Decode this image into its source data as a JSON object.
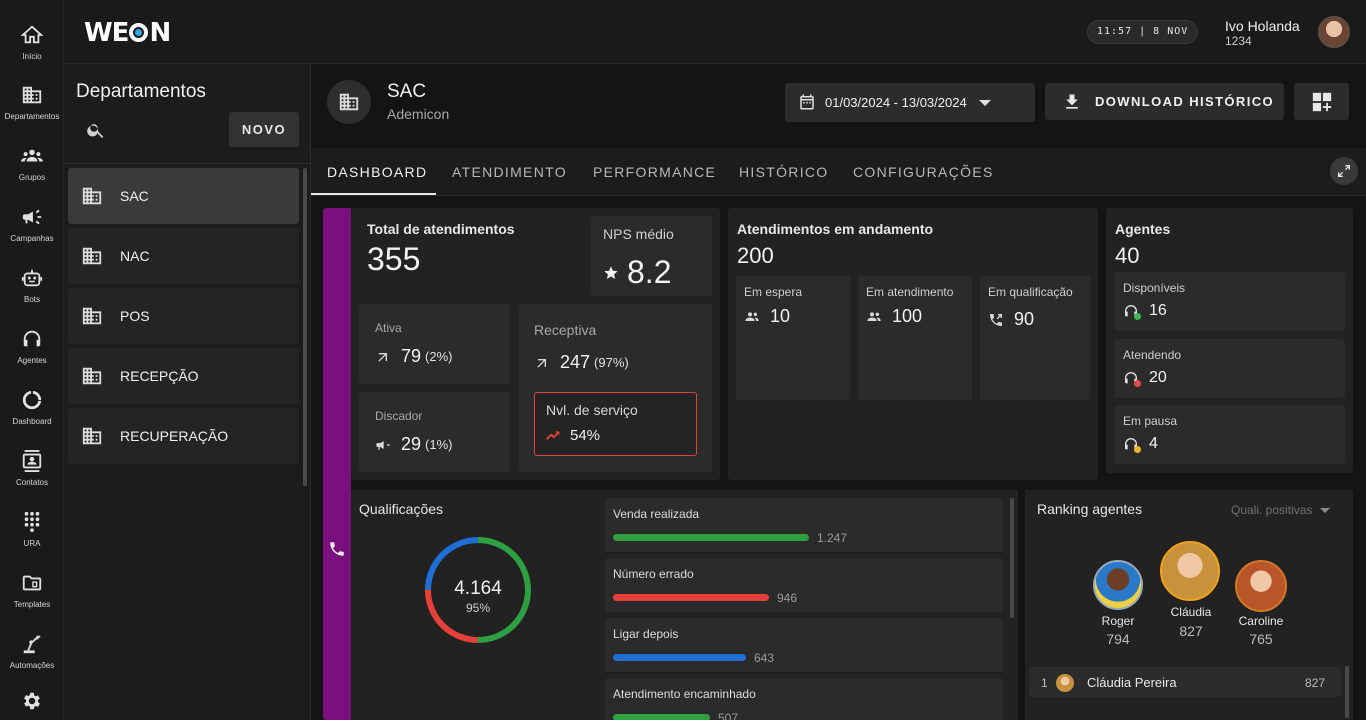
{
  "app": {
    "logo_left": "WE",
    "logo_right": "N",
    "clock": "11:57  |  8 NOV",
    "user_name": "Ivo Holanda",
    "user_id": "1234"
  },
  "rail": [
    {
      "label": "Início",
      "icon": "home-icon"
    },
    {
      "label": "Departamentos",
      "icon": "building-icon"
    },
    {
      "label": "Grupos",
      "icon": "groups-icon"
    },
    {
      "label": "Campanhas",
      "icon": "megaphone-icon"
    },
    {
      "label": "Bots",
      "icon": "robot-icon"
    },
    {
      "label": "Agentes",
      "icon": "headset-icon"
    },
    {
      "label": "Dashboard",
      "icon": "donut-icon"
    },
    {
      "label": "Contatos",
      "icon": "contacts-icon"
    },
    {
      "label": "URA",
      "icon": "dialpad-icon"
    },
    {
      "label": "Templates",
      "icon": "folder-icon"
    },
    {
      "label": "Automações",
      "icon": "robot-arm-icon"
    },
    {
      "label": "",
      "icon": "gear-icon"
    }
  ],
  "departments": {
    "title": "Departamentos",
    "new_label": "NOVO",
    "items": [
      "SAC",
      "NAC",
      "POS",
      "RECEPÇÃO",
      "RECUPERAÇÃO"
    ]
  },
  "header": {
    "title": "SAC",
    "subtitle": "Ademicon",
    "date_range": "01/03/2024 - 13/03/2024",
    "download_label": "DOWNLOAD HISTÓRICO"
  },
  "tabs": [
    "DASHBOARD",
    "ATENDIMENTO",
    "PERFORMANCE",
    "HISTÓRICO",
    "CONFIGURAÇÕES"
  ],
  "totals": {
    "title": "Total de atendimentos",
    "value": "355",
    "nps_label": "NPS médio",
    "nps_value": "8.2",
    "ativa_label": "Ativa",
    "ativa_value": "79",
    "ativa_pct": "(2%)",
    "receptiva_label": "Receptiva",
    "receptiva_value": "247",
    "receptiva_pct": "(97%)",
    "discador_label": "Discador",
    "discador_value": "29",
    "discador_pct": "(1%)",
    "servico_label": "Nvl. de serviço",
    "servico_value": "54%"
  },
  "andamento": {
    "title": "Atendimentos em andamento",
    "value": "200",
    "espera_label": "Em espera",
    "espera_value": "10",
    "atendimento_label": "Em atendimento",
    "atendimento_value": "100",
    "qualificacao_label": "Em qualificação",
    "qualificacao_value": "90"
  },
  "agentes": {
    "title": "Agentes",
    "value": "40",
    "items": [
      {
        "label": "Disponíveis",
        "value": "16",
        "status_color": "#3fb950"
      },
      {
        "label": "Atendendo",
        "value": "20",
        "status_color": "#e5484d"
      },
      {
        "label": "Em pausa",
        "value": "4",
        "status_color": "#f0b429"
      }
    ]
  },
  "qualificacoes": {
    "title": "Qualificações",
    "total": "4.164",
    "pct": "95%",
    "items": [
      {
        "label": "Venda realizada",
        "value": "1.247",
        "fraction": 0.85,
        "color": "#2ea043"
      },
      {
        "label": "Número errado",
        "value": "946",
        "fraction": 0.68,
        "color": "#e5403a"
      },
      {
        "label": "Ligar depois",
        "value": "643",
        "fraction": 0.58,
        "color": "#1f6fd6"
      },
      {
        "label": "Atendimento encaminhado",
        "value": "507",
        "fraction": 0.42,
        "color": "#2ea043"
      }
    ],
    "donut_segments": [
      {
        "fraction": 0.5,
        "color": "#2ea043"
      },
      {
        "fraction": 0.25,
        "color": "#e5403a"
      },
      {
        "fraction": 0.25,
        "color": "#1f6fd6"
      }
    ]
  },
  "ranking": {
    "title": "Ranking agentes",
    "filter": "Quali. positivas",
    "podium": [
      {
        "name": "Roger",
        "score": "794"
      },
      {
        "name": "Cláudia",
        "score": "827"
      },
      {
        "name": "Caroline",
        "score": "765"
      }
    ],
    "list": [
      {
        "pos": "1",
        "name": "Cláudia Pereira",
        "score": "827"
      }
    ]
  }
}
